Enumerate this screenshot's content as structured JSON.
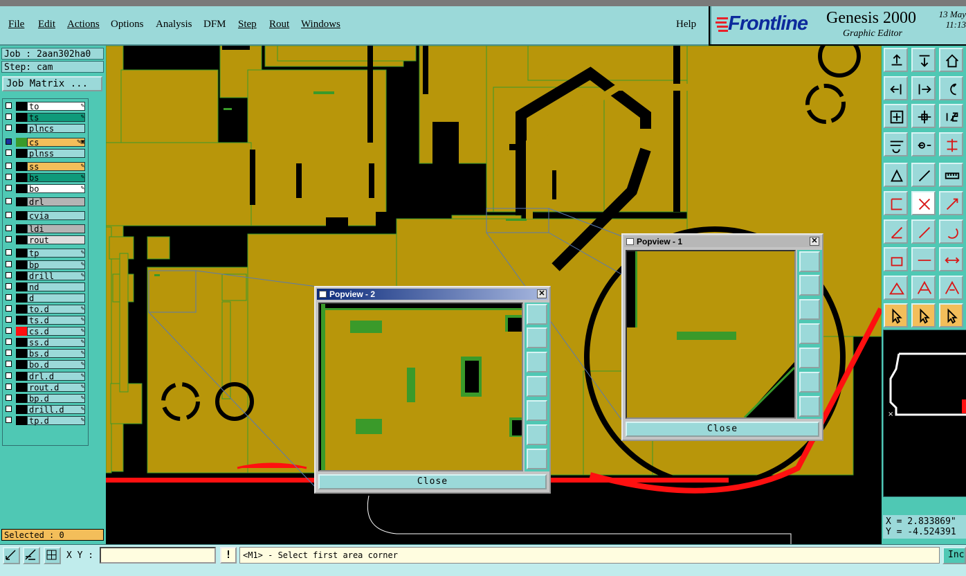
{
  "menubar": {
    "items": [
      "File",
      "Edit",
      "Actions",
      "Options",
      "Analysis",
      "DFM",
      "Step",
      "Rout",
      "Windows"
    ],
    "help": "Help"
  },
  "brand": {
    "logo": "Frontline",
    "product": "Genesis 2000",
    "subtitle": "Graphic Editor",
    "date": "13 May",
    "time": "11:13"
  },
  "left": {
    "job": "Job : 2aan302ha0",
    "step": "Step: cam",
    "job_matrix": "Job Matrix ...",
    "selected": "Selected : 0",
    "layers": [
      {
        "name": "to",
        "bg": "#ffffff",
        "color": "#000000",
        "mark": "✎"
      },
      {
        "name": "ts",
        "bg": "#0f9a7a",
        "color": "#000000",
        "mark": "✎"
      },
      {
        "name": "plncs",
        "bg": "#9bd9d9",
        "color": "#000000",
        "mark": ""
      },
      {
        "name": "cs",
        "bg": "#f3be5a",
        "color": "#3a9a2a",
        "mark": "✎▣",
        "on": true
      },
      {
        "name": "plnss",
        "bg": "#9bd9d9",
        "color": "#000000",
        "mark": ""
      },
      {
        "name": "ss",
        "bg": "#f3be5a",
        "color": "#000000",
        "mark": "✎"
      },
      {
        "name": "bs",
        "bg": "#0f9a7a",
        "color": "#000000",
        "mark": "✎"
      },
      {
        "name": "bo",
        "bg": "#ffffff",
        "color": "#000000",
        "mark": "✎"
      },
      {
        "name": "drl",
        "bg": "#b4b4b4",
        "color": "#000000",
        "mark": ""
      },
      {
        "name": "cvia",
        "bg": "#9bd9d9",
        "color": "#000000",
        "mark": ""
      },
      {
        "name": "ldi",
        "bg": "#b4b4b4",
        "color": "#000000",
        "mark": ""
      },
      {
        "name": "rout",
        "bg": "#dddddd",
        "color": "#000000",
        "mark": ""
      },
      {
        "name": "tp",
        "bg": "#9bd9d9",
        "color": "#000000",
        "mark": "✎"
      },
      {
        "name": "bp",
        "bg": "#9bd9d9",
        "color": "#000000",
        "mark": "✎"
      },
      {
        "name": "drill",
        "bg": "#9bd9d9",
        "color": "#000000",
        "mark": "✎"
      },
      {
        "name": "nd",
        "bg": "#9bd9d9",
        "color": "#000000",
        "mark": ""
      },
      {
        "name": "d",
        "bg": "#9bd9d9",
        "color": "#000000",
        "mark": ""
      },
      {
        "name": "to.d",
        "bg": "#9bd9d9",
        "color": "#000000",
        "mark": "✎"
      },
      {
        "name": "ts.d",
        "bg": "#9bd9d9",
        "color": "#000000",
        "mark": "✎"
      },
      {
        "name": "cs.d",
        "bg": "#9bd9d9",
        "color": "#ff1010",
        "mark": "✎"
      },
      {
        "name": "ss.d",
        "bg": "#9bd9d9",
        "color": "#000000",
        "mark": "✎"
      },
      {
        "name": "bs.d",
        "bg": "#9bd9d9",
        "color": "#000000",
        "mark": "✎"
      },
      {
        "name": "bo.d",
        "bg": "#9bd9d9",
        "color": "#000000",
        "mark": "✎"
      },
      {
        "name": "drl.d",
        "bg": "#9bd9d9",
        "color": "#000000",
        "mark": "✎"
      },
      {
        "name": "rout.d",
        "bg": "#9bd9d9",
        "color": "#000000",
        "mark": "✎"
      },
      {
        "name": "bp.d",
        "bg": "#9bd9d9",
        "color": "#000000",
        "mark": "✎"
      },
      {
        "name": "drill.d",
        "bg": "#9bd9d9",
        "color": "#000000",
        "mark": "✎"
      },
      {
        "name": "tp.d",
        "bg": "#9bd9d9",
        "color": "#000000",
        "mark": "✎"
      }
    ]
  },
  "popview1": {
    "title": "Popview - 1",
    "close": "Close"
  },
  "popview2": {
    "title": "Popview - 2",
    "close": "Close"
  },
  "coords": {
    "x": "X = 2.833869\"",
    "y": "Y = -4.524391"
  },
  "bottom": {
    "xy_label": "X Y :",
    "xy_value": "",
    "warn": "!",
    "message": "<M1> - Select first area corner",
    "inc": "Inc"
  },
  "colors": {
    "copper": "#b8960a",
    "outline": "#3a9a2a",
    "route": "#ff1010",
    "panel": "#4fc8b4",
    "light": "#9bd9d9"
  }
}
